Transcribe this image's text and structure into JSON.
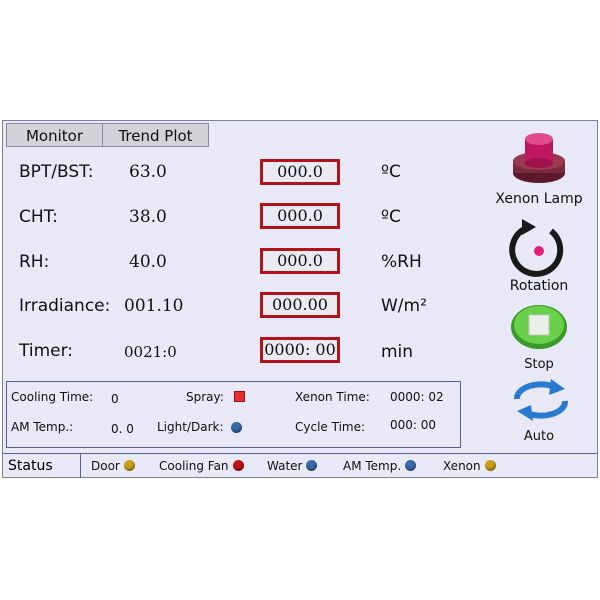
{
  "tabs": {
    "monitor": "Monitor",
    "trend_plot": "Trend Plot"
  },
  "rows": [
    {
      "label": "BPT/BST:",
      "value": "63.0",
      "setpoint": "000.0",
      "unit": "ºC"
    },
    {
      "label": "CHT:",
      "value": "38.0",
      "setpoint": "000.0",
      "unit": "ºC"
    },
    {
      "label": "RH:",
      "value": "40.0",
      "setpoint": "000.0",
      "unit": "%RH"
    },
    {
      "label": "Irradiance:",
      "value": "001.10",
      "setpoint": "000.00",
      "unit": "W/m²"
    },
    {
      "label": "Timer:",
      "value": "0021:0",
      "setpoint": "0000: 00",
      "unit": "min"
    }
  ],
  "info": {
    "cooling_time_label": "Cooling Time:",
    "cooling_time_value": "0",
    "spray_label": "Spray:",
    "xenon_time_label": "Xenon Time:",
    "xenon_time_value": "0000: 02",
    "am_temp_label": "AM Temp.:",
    "am_temp_value": "0. 0",
    "light_dark_label": "Light/Dark:",
    "cycle_time_label": "Cycle Time:",
    "cycle_time_value": "000: 00"
  },
  "status": {
    "label": "Status",
    "items": [
      {
        "label": "Door",
        "color": "#c8a018"
      },
      {
        "label": "Cooling Fan",
        "color": "#c01418"
      },
      {
        "label": "Water",
        "color": "#3a6aa8"
      },
      {
        "label": "AM Temp.",
        "color": "#3a6aa8"
      },
      {
        "label": "Xenon",
        "color": "#c8a018"
      }
    ]
  },
  "side": {
    "xenon_lamp": "Xenon Lamp",
    "rotation": "Rotation",
    "stop": "Stop",
    "auto": "Auto"
  },
  "colors": {
    "spray_indicator": "#e03030",
    "light_dark_indicator": "#3a6aa8"
  }
}
